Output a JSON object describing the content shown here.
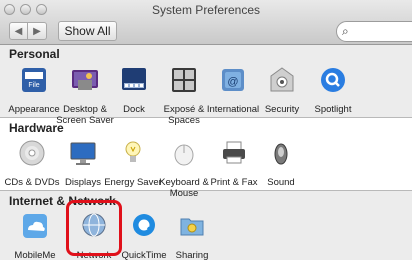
{
  "window": {
    "title": "System Preferences"
  },
  "toolbar": {
    "back_label": "◀",
    "forward_label": "▶",
    "show_all_label": "Show All",
    "search_placeholder": "",
    "search_icon": "magnifier-icon"
  },
  "sections": [
    {
      "label": "Personal",
      "items": [
        {
          "label": "Appearance",
          "icon": "appearance-icon"
        },
        {
          "label": "Desktop & Screen Saver",
          "icon": "desktop-icon"
        },
        {
          "label": "Dock",
          "icon": "dock-icon"
        },
        {
          "label": "Exposé & Spaces",
          "icon": "expose-icon"
        },
        {
          "label": "International",
          "icon": "international-icon"
        },
        {
          "label": "Security",
          "icon": "security-icon"
        },
        {
          "label": "Spotlight",
          "icon": "spotlight-icon"
        }
      ]
    },
    {
      "label": "Hardware",
      "items": [
        {
          "label": "CDs & DVDs",
          "icon": "cd-icon"
        },
        {
          "label": "Displays",
          "icon": "display-icon"
        },
        {
          "label": "Energy Saver",
          "icon": "energy-icon"
        },
        {
          "label": "Keyboard & Mouse",
          "icon": "keyboard-icon"
        },
        {
          "label": "Print & Fax",
          "icon": "printer-icon"
        },
        {
          "label": "Sound",
          "icon": "speaker-icon"
        }
      ]
    },
    {
      "label": "Internet & Network",
      "items": [
        {
          "label": "MobileMe",
          "icon": "mobileme-icon"
        },
        {
          "label": "Network",
          "icon": "network-icon",
          "highlighted": true
        },
        {
          "label": "QuickTime",
          "icon": "quicktime-icon"
        },
        {
          "label": "Sharing",
          "icon": "sharing-icon"
        }
      ]
    }
  ],
  "colors": {
    "highlight": "#e0101a",
    "spotlight": "#2a7de1",
    "quicktime": "#1f8be0"
  }
}
